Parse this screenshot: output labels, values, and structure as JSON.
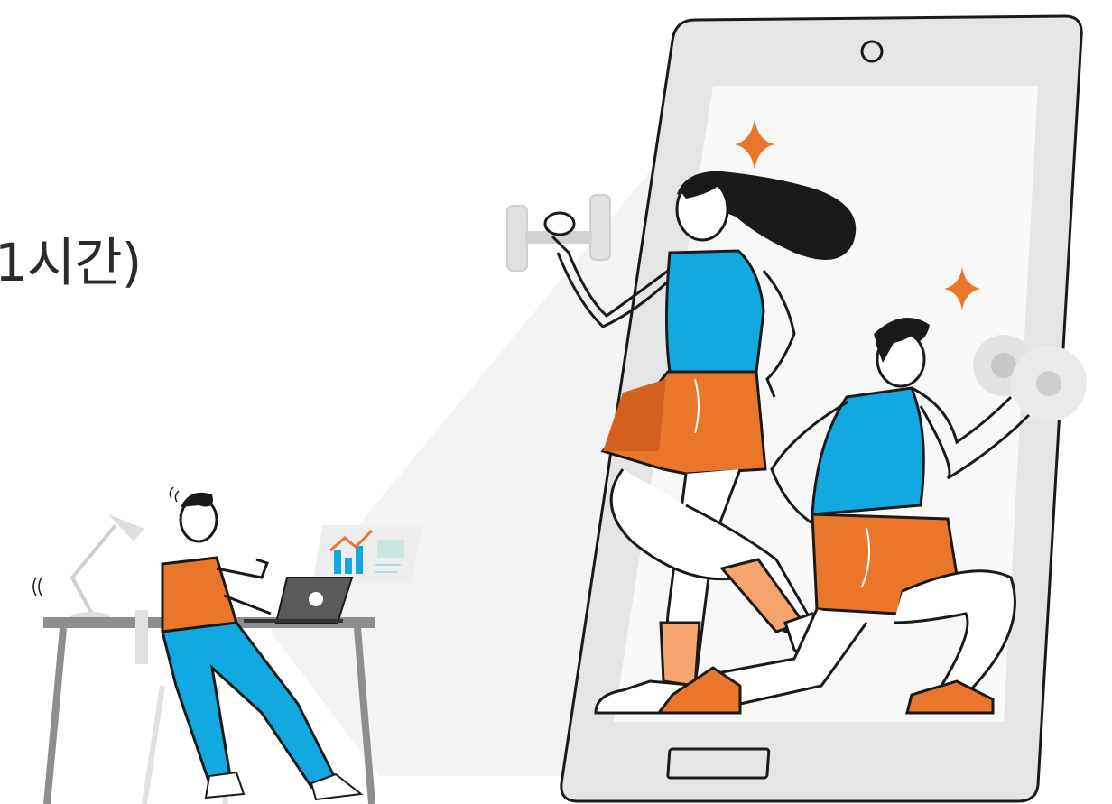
{
  "headline": {
    "text": "1시간)"
  },
  "illustration": {
    "icons": [
      "desk-lamp-icon",
      "laptop-icon",
      "growth-chart-icon",
      "smartphone-icon",
      "dumbbell-icon",
      "sparkle-icon"
    ],
    "colors": {
      "accent_orange": "#E9762B",
      "accent_blue": "#12A9E0",
      "skin": "#FFFFFF",
      "outline": "#1A1A1A",
      "phone_body": "#E6E6E6",
      "phone_screen": "#F7F7F7",
      "shadow_beam": "#F1F1F1"
    }
  }
}
